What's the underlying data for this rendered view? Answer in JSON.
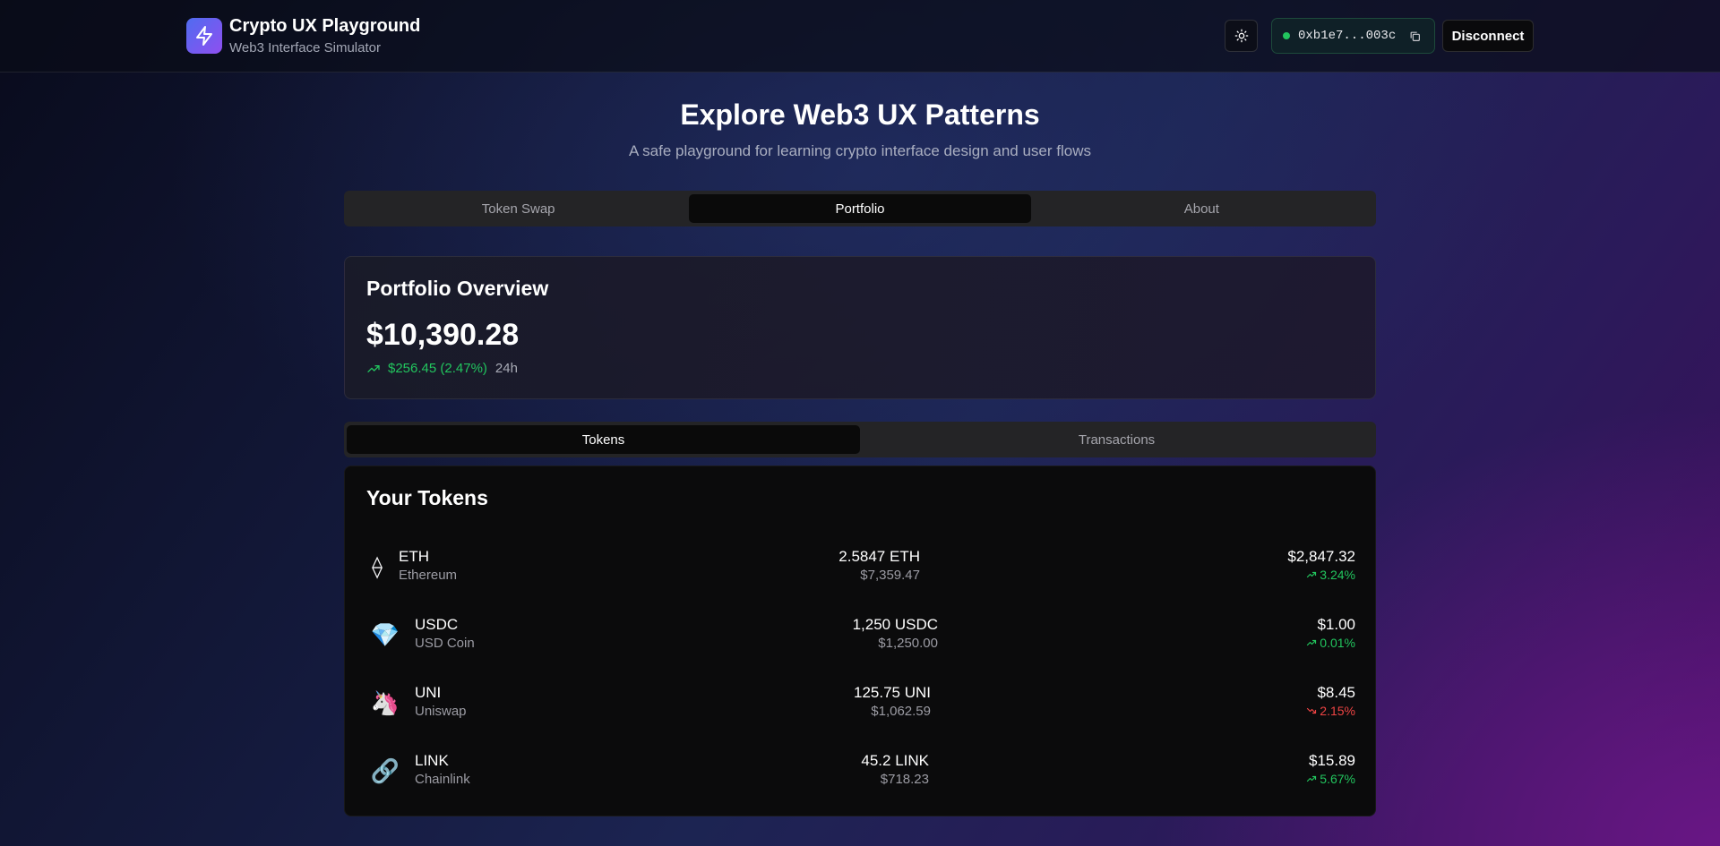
{
  "app": {
    "title": "Crypto UX Playground",
    "subtitle": "Web3 Interface Simulator",
    "logo_icon": "lightning-bolt-icon"
  },
  "header": {
    "theme_icon": "sun-icon",
    "wallet": {
      "status_color": "#22c55e",
      "address": "0xb1e7...003c",
      "copy_icon": "copy-icon"
    },
    "disconnect_label": "Disconnect"
  },
  "hero": {
    "title": "Explore Web3 UX Patterns",
    "subtitle": "A safe playground for learning crypto interface design and user flows"
  },
  "main_tabs": [
    {
      "label": "Token Swap",
      "active": false
    },
    {
      "label": "Portfolio",
      "active": true
    },
    {
      "label": "About",
      "active": false
    }
  ],
  "overview": {
    "title": "Portfolio Overview",
    "total_value": "$10,390.28",
    "change": "$256.45 (2.47%)",
    "period": "24h",
    "change_icon": "trending-up-icon"
  },
  "sub_tabs": [
    {
      "label": "Tokens",
      "active": true
    },
    {
      "label": "Transactions",
      "active": false
    }
  ],
  "tokens": {
    "title": "Your Tokens",
    "items": [
      {
        "icon": "⟠",
        "icon_name": "ethereum-icon",
        "symbol": "ETH",
        "name": "Ethereum",
        "balance": "2.5847 ETH",
        "value": "$7,359.47",
        "price": "$2,847.32",
        "change": "3.24%",
        "direction": "up"
      },
      {
        "icon": "💎",
        "icon_name": "gem-icon",
        "symbol": "USDC",
        "name": "USD Coin",
        "balance": "1,250 USDC",
        "value": "$1,250.00",
        "price": "$1.00",
        "change": "0.01%",
        "direction": "up"
      },
      {
        "icon": "🦄",
        "icon_name": "unicorn-icon",
        "symbol": "UNI",
        "name": "Uniswap",
        "balance": "125.75 UNI",
        "value": "$1,062.59",
        "price": "$8.45",
        "change": "2.15%",
        "direction": "down"
      },
      {
        "icon": "🔗",
        "icon_name": "link-icon",
        "symbol": "LINK",
        "name": "Chainlink",
        "balance": "45.2 LINK",
        "value": "$718.23",
        "price": "$15.89",
        "change": "5.67%",
        "direction": "up"
      }
    ]
  },
  "colors": {
    "positive": "#22c55e",
    "negative": "#ef4444",
    "logo_gradient_start": "#4f6cf0",
    "logo_gradient_end": "#8f4ff0"
  }
}
